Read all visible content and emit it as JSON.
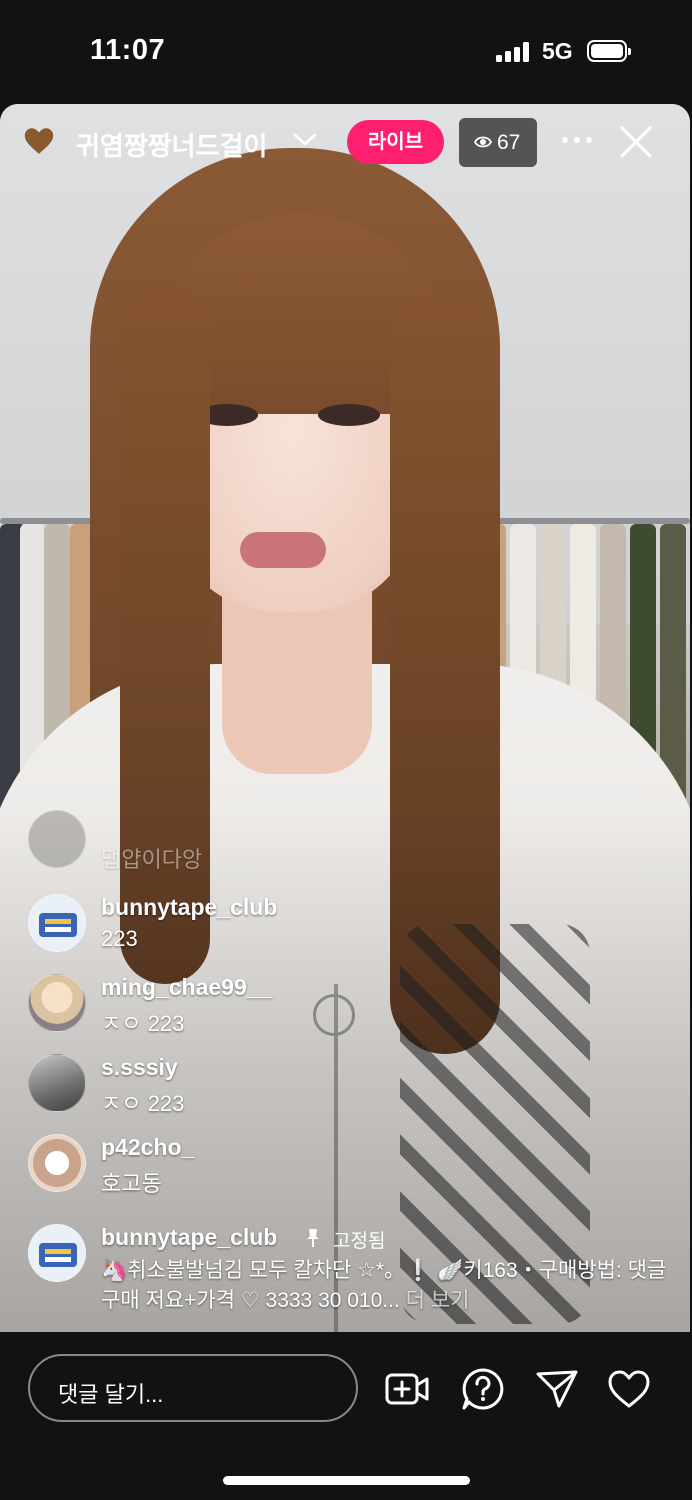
{
  "status_bar": {
    "time": "11:07",
    "network": "5G"
  },
  "header": {
    "username": "귀염짱짱너드걸이",
    "live_label": "라이브",
    "viewer_count": "67"
  },
  "comments": [
    {
      "user": "",
      "text": "댑얍이다앙"
    },
    {
      "user": "bunnytape_club",
      "text": "223"
    },
    {
      "user": "ming_chae99__",
      "text": "ㅈㅇ 223"
    },
    {
      "user": "s.sssiy",
      "text": "ㅈㅇ 223"
    },
    {
      "user": "p42cho_",
      "text": "호고동"
    }
  ],
  "pinned": {
    "user": "bunnytape_club",
    "pinned_label": "고정됨",
    "text": "🦄취소불발넘김 모두 칼차단 ☆*。❕ 🪽키163・구매방법: 댓글구매 저요+가격 ♡ 3333 30 010...",
    "more": "더 보기"
  },
  "bottom_bar": {
    "comment_placeholder": "댓글 달기..."
  },
  "colors": {
    "live": "#ff1f70",
    "background": "#121212"
  },
  "icons": [
    "heart-avatar-icon",
    "chevron-down-icon",
    "eye-icon",
    "more-icon",
    "close-icon",
    "pin-icon",
    "add-video-icon",
    "question-icon",
    "send-icon",
    "heart-icon"
  ]
}
